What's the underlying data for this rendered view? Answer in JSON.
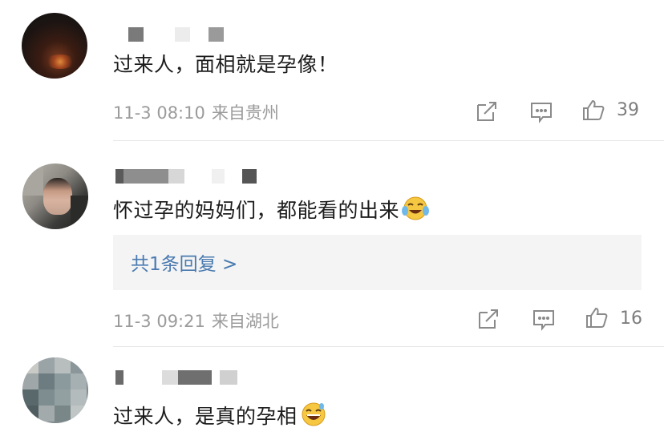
{
  "comments": [
    {
      "text": "过来人，面相就是孕像！",
      "timestamp": "11-3 08:10",
      "location": "来自贵州",
      "likes": "39",
      "emoji": null
    },
    {
      "text": "怀过孕的妈妈们，都能看的出来",
      "timestamp": "11-3 09:21",
      "location": "来自湖北",
      "likes": "16",
      "emoji": "crying-laughing-emoji",
      "reply_label": "共1条回复 >"
    },
    {
      "text": "过来人，是真的孕相",
      "emoji": "grinning-sweat-emoji"
    }
  ],
  "colors": {
    "meta": "#9b9b9b",
    "reply_link": "#4a7ab0",
    "reply_bg": "#f4f4f4",
    "icon": "#8a8a8a"
  },
  "icons": [
    "share-icon",
    "comment-icon",
    "like-icon"
  ]
}
